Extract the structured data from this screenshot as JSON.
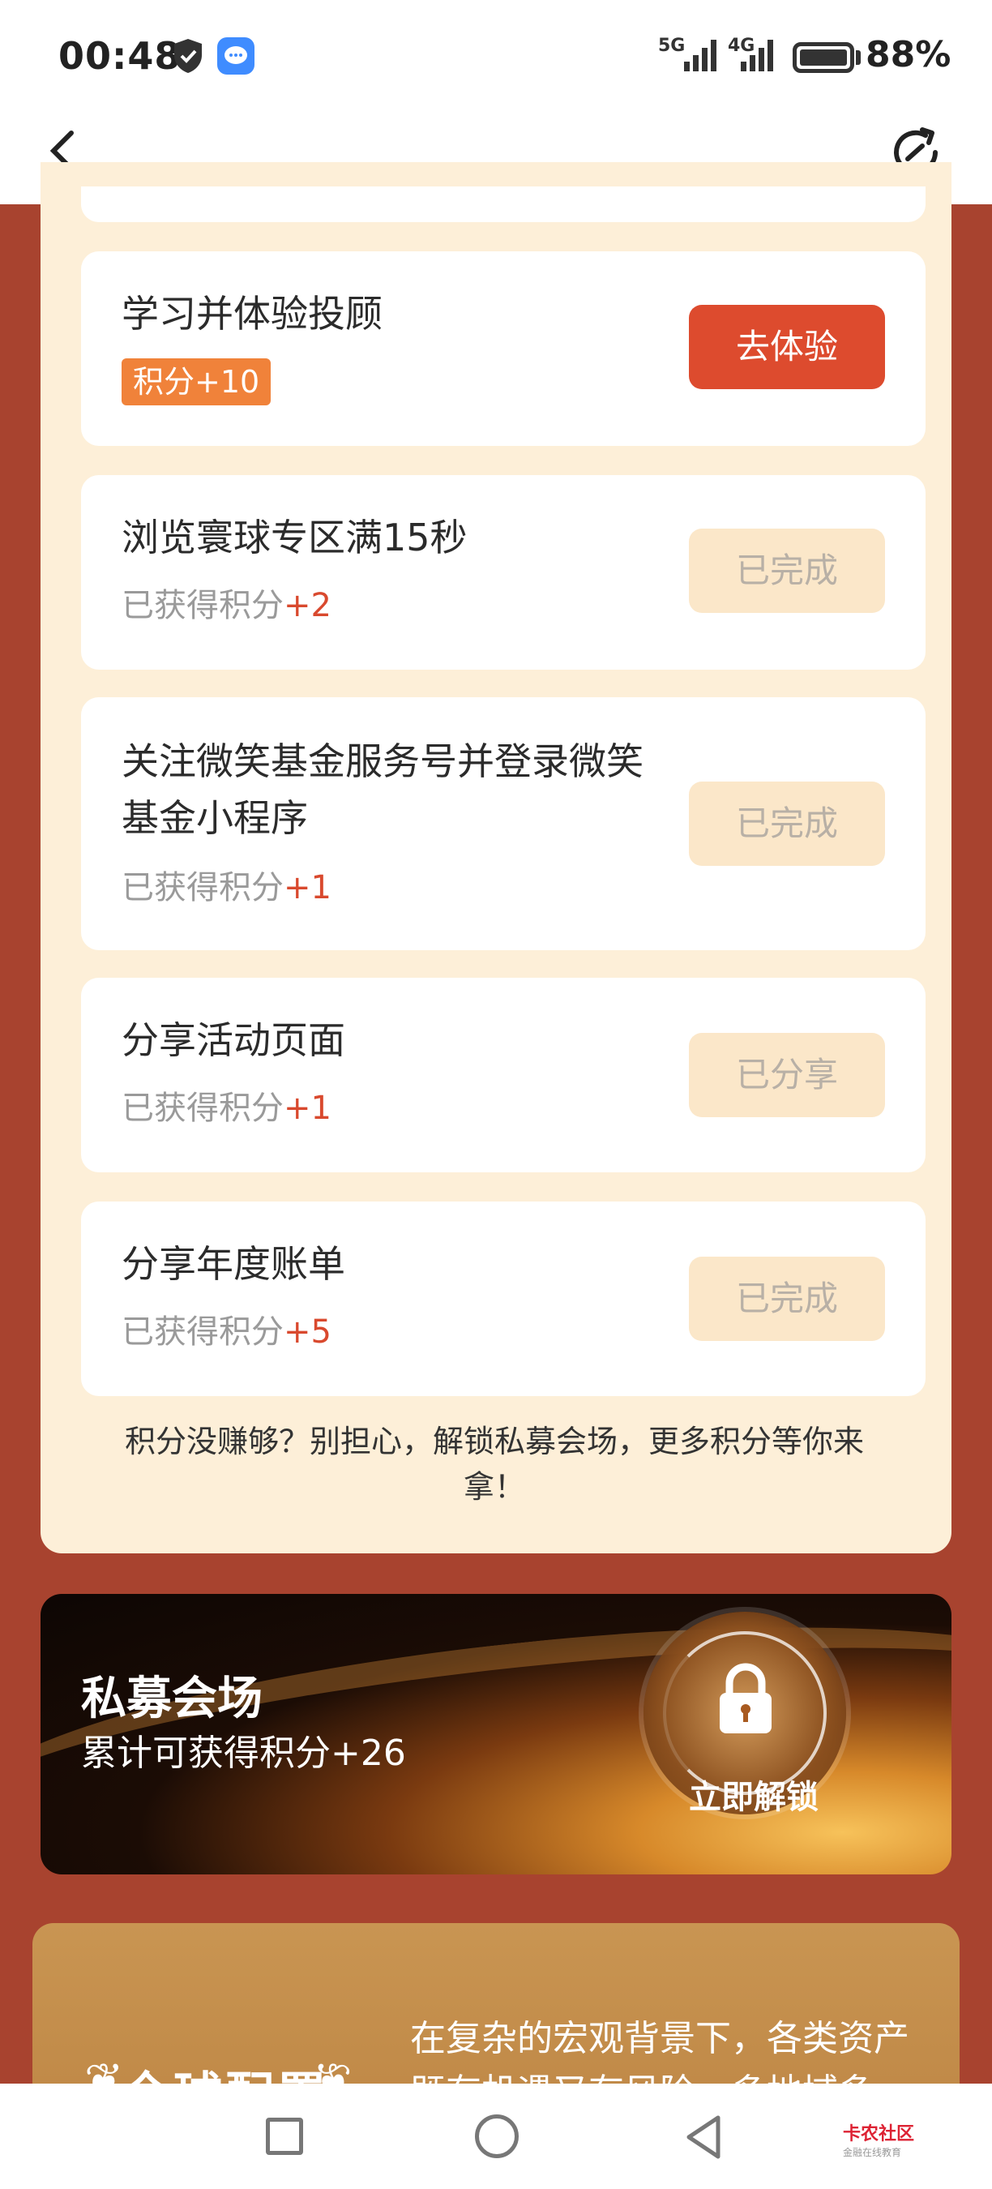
{
  "status_bar": {
    "time": "00:48",
    "net1": "5G",
    "net2": "4G",
    "battery": "88%"
  },
  "tasks": [
    {
      "title": "学习并体验投顾",
      "badge": "积分+10",
      "button": "去体验"
    },
    {
      "title": "浏览寰球专区满15秒",
      "earned_prefix": "已获得积分",
      "earned_pts": "+2",
      "button": "已完成"
    },
    {
      "title": "关注微笑基金服务号并登录微笑基金小程序",
      "earned_prefix": "已获得积分",
      "earned_pts": "+1",
      "button": "已完成"
    },
    {
      "title": "分享活动页面",
      "earned_prefix": "已获得积分",
      "earned_pts": "+1",
      "button": "已分享"
    },
    {
      "title": "分享年度账单",
      "earned_prefix": "已获得积分",
      "earned_pts": "+5",
      "button": "已完成"
    }
  ],
  "hint": "积分没赚够？别担心，解锁私募会场，更多积分等你来拿！",
  "private_banner": {
    "title": "私募会场",
    "subtitle": "累计可获得积分+26",
    "unlock_label": "立即解锁"
  },
  "global_card": {
    "title": "全球配置",
    "text": "在复杂的宏观背景下，各类资产既有机遇又有风险，多地域多"
  },
  "watermark": {
    "brand": "卡农社区",
    "tagline": "金融在线教育"
  },
  "colors": {
    "background": "#a8432f",
    "panel": "#fdefd8",
    "primary_button": "#dd4b2e",
    "done_button": "#fbe7c9",
    "badge": "#f0823a",
    "points": "#d9492e"
  }
}
